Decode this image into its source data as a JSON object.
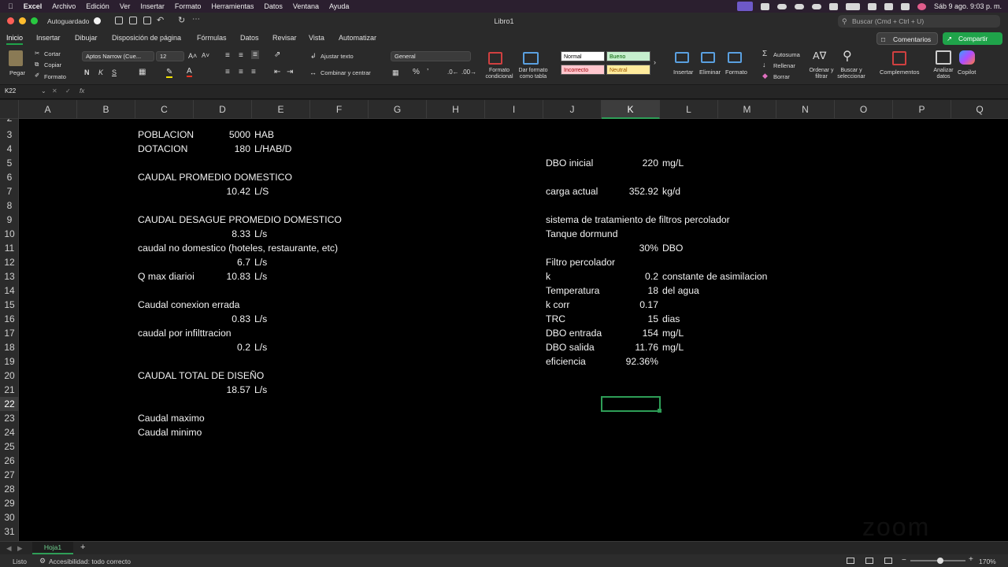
{
  "menubar": {
    "app": "Excel",
    "items": [
      "Archivo",
      "Edición",
      "Ver",
      "Insertar",
      "Formato",
      "Herramientas",
      "Datos",
      "Ventana",
      "Ayuda"
    ],
    "clock": "Sáb 9 ago.  9:03 p. m."
  },
  "titlebar": {
    "autosave": "Autoguardado",
    "doc_title": "Libro1",
    "search_placeholder": "Buscar (Cmd + Ctrl + U)"
  },
  "ribbon_tabs": [
    "Inicio",
    "Insertar",
    "Dibujar",
    "Disposición de página",
    "Fórmulas",
    "Datos",
    "Revisar",
    "Vista",
    "Automatizar"
  ],
  "ribbon_actions": {
    "comments": "Comentarios",
    "share": "Compartir"
  },
  "ribbon": {
    "paste": "Pegar",
    "cut": "Cortar",
    "copy": "Copiar",
    "format_painter": "Formato",
    "font_name": "Aptos Narrow (Cue...",
    "font_size": "12",
    "bold": "N",
    "italic": "K",
    "underline": "S",
    "wrap_text": "Ajustar texto",
    "merge_center": "Combinar y centrar",
    "number_format": "General",
    "cond_format": "Formato condicional",
    "format_table": "Dar formato como tabla",
    "styles": {
      "normal": "Normal",
      "bueno": "Bueno",
      "incorrecto": "Incorrecto",
      "neutral": "Neutral"
    },
    "insert": "Insertar",
    "delete": "Eliminar",
    "format": "Formato",
    "autosum": "Autosuma",
    "fill": "Rellenar",
    "clear": "Borrar",
    "sort_filter": "Ordenar y filtrar",
    "find_select": "Buscar y seleccionar",
    "addins": "Complementos",
    "analyze": "Analizar datos",
    "copilot": "Copilot"
  },
  "formula_bar": {
    "name_box": "K22",
    "fx": "fx",
    "content": ""
  },
  "columns": [
    "A",
    "B",
    "C",
    "D",
    "E",
    "F",
    "G",
    "H",
    "I",
    "J",
    "K",
    "L",
    "M",
    "N",
    "O",
    "P",
    "Q"
  ],
  "selected_column": "K",
  "rows": [
    "2",
    "3",
    "4",
    "5",
    "6",
    "7",
    "8",
    "9",
    "10",
    "11",
    "12",
    "13",
    "14",
    "15",
    "16",
    "17",
    "18",
    "19",
    "20",
    "21",
    "22",
    "23",
    "24",
    "25",
    "26",
    "27",
    "28",
    "29",
    "30",
    "31"
  ],
  "selected_row": "22",
  "cells": {
    "C3": "POBLACION",
    "D3": "5000",
    "E3": "HAB",
    "C4": "DOTACION",
    "D4": "180",
    "E4": "L/HAB/D",
    "J5": "DBO inicial",
    "K5": "220",
    "L5": "mg/L",
    "C6": "CAUDAL PROMEDIO DOMESTICO",
    "D7": "10.42",
    "E7": "L/S",
    "J7": "carga actual",
    "K7": "352.92",
    "L7": "kg/d",
    "C9": "CAUDAL DESAGUE PROMEDIO DOMESTICO",
    "J9": "sistema de tratamiento de filtros percolador",
    "D10": "8.33",
    "E10": "L/s",
    "J10": "Tanque dormund",
    "C11": "caudal no domestico (hoteles, restaurante, etc)",
    "K11": "30%",
    "L11": "DBO",
    "D12": "6.7",
    "E12": "L/s",
    "J12": "Filtro percolador",
    "C13": "Q max diarioi",
    "D13": "10.83",
    "E13": "L/s",
    "J13": "k",
    "K13": "0.2",
    "L13": "constante de asimilacion",
    "J14": "Temperatura",
    "K14": "18",
    "L14": "del agua",
    "C15": "Caudal conexion errada",
    "J15": "k corr",
    "K15": "0.17",
    "D16": "0.83",
    "E16": "L/s",
    "J16": "TRC",
    "K16": "15",
    "L16": "dias",
    "C17": "caudal por infilttracion",
    "J17": "DBO entrada",
    "K17": "154",
    "L17": "mg/L",
    "D18": "0.2",
    "E18": "L/s",
    "J18": "DBO salida",
    "K18": "11.76",
    "L18": "mg/L",
    "J19": "eficiencia",
    "K19": "92.36%",
    "C20": "CAUDAL TOTAL DE DISEÑO",
    "D21": "18.57",
    "E21": "L/s",
    "C23": "Caudal maximo",
    "C24": "Caudal minimo"
  },
  "sheet_tabs": [
    "Hoja1"
  ],
  "status": {
    "ready": "Listo",
    "accessibility": "Accesibilidad: todo correcto",
    "zoom": "170%"
  },
  "watermark": "zoom",
  "colors": {
    "accent": "#2e9e57",
    "share": "#1fa34a",
    "bueno_bg": "#c6efce",
    "incorrecto_bg": "#ffc7ce",
    "neutral_bg": "#ffeb9c"
  }
}
